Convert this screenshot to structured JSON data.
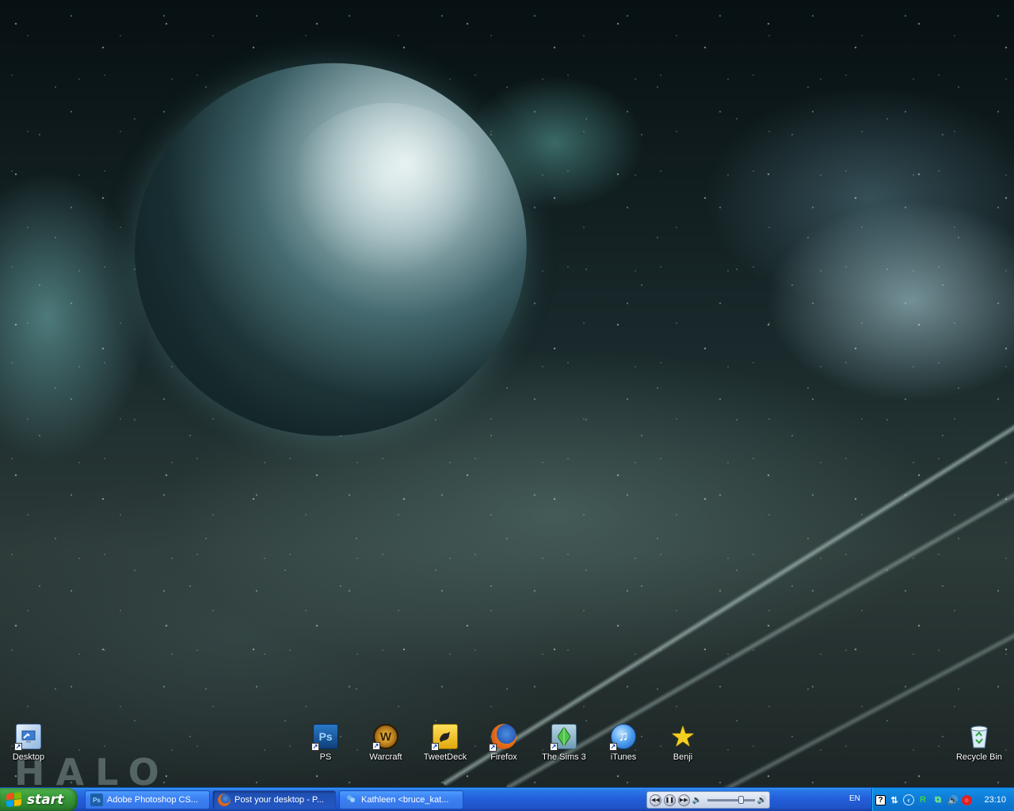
{
  "desktop": {
    "wallpaper_logo": "HALO",
    "icons": [
      {
        "id": "desktop",
        "label": "Desktop",
        "icon": "desktop-shortcut-icon",
        "color": "#3a7fd6"
      },
      {
        "id": "ps",
        "label": "PS",
        "icon": "photoshop-icon",
        "glyph": "Ps",
        "color": "#1c5fa8"
      },
      {
        "id": "warcraft",
        "label": "Warcraft",
        "icon": "world-of-warcraft-icon",
        "glyph": "W",
        "color": "#6b4a12"
      },
      {
        "id": "tweetdeck",
        "label": "TweetDeck",
        "icon": "tweetdeck-icon",
        "color": "#f2c418"
      },
      {
        "id": "firefox",
        "label": "Firefox",
        "icon": "firefox-icon",
        "color": "#e8741a"
      },
      {
        "id": "sims3",
        "label": "The Sims 3",
        "icon": "sims-plumbob-icon",
        "color": "#4fc24a"
      },
      {
        "id": "itunes",
        "label": "iTunes",
        "icon": "itunes-icon",
        "glyph": "♫",
        "color": "#2f7fd8"
      },
      {
        "id": "benji",
        "label": "Benji",
        "icon": "star-icon",
        "glyph": "★",
        "color": "#f5d020"
      },
      {
        "id": "recycle",
        "label": "Recycle Bin",
        "icon": "recycle-bin-icon",
        "color": "#cfe4f0"
      }
    ]
  },
  "taskbar": {
    "start_label": "start",
    "tasks": [
      {
        "label": "Adobe Photoshop CS...",
        "icon": "photoshop-icon",
        "glyph": "Ps",
        "active": false
      },
      {
        "label": "Post your desktop - P...",
        "icon": "firefox-icon",
        "glyph": "",
        "active": true
      },
      {
        "label": "Kathleen <bruce_kat...",
        "icon": "messenger-icon",
        "glyph": "",
        "active": false
      }
    ],
    "media": {
      "controls": [
        "previous-icon",
        "pause-icon",
        "next-icon",
        "volume-icon"
      ],
      "volume_level": 0.75
    },
    "tray": {
      "language": "EN",
      "icons": [
        "help-icon",
        "network-arrow-icon",
        "back-arrow-icon",
        "r-app-icon",
        "network-icon",
        "sound-icon",
        "security-shield-icon"
      ],
      "clock": "23:10"
    }
  },
  "colors": {
    "taskbar_blue": "#245edb",
    "start_green": "#3c9e3c",
    "tray_blue": "#0f7ed8"
  }
}
